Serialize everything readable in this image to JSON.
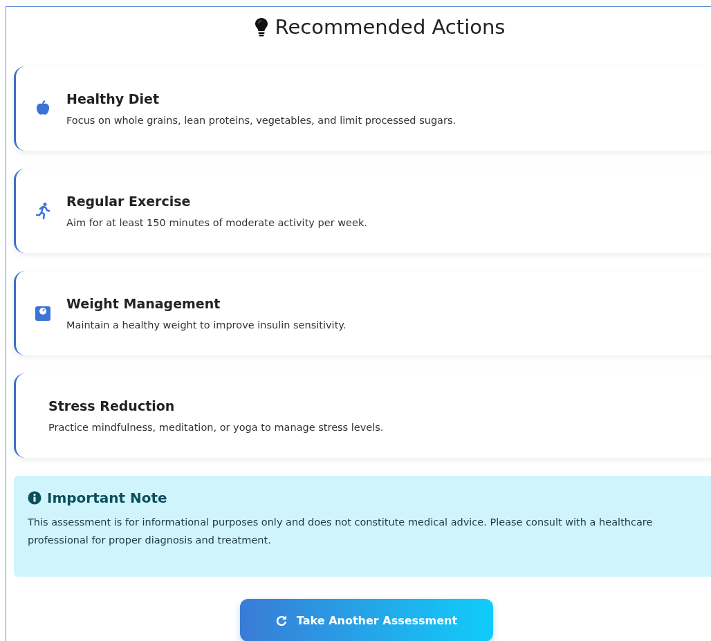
{
  "section": {
    "title": "Recommended Actions"
  },
  "actions": [
    {
      "kind": "apple",
      "title": "Healthy Diet",
      "text": "Focus on whole grains, lean proteins, vegetables, and limit processed sugars."
    },
    {
      "kind": "runner",
      "title": "Regular Exercise",
      "text": "Aim for at least 150 minutes of moderate activity per week."
    },
    {
      "kind": "scale",
      "title": "Weight Management",
      "text": "Maintain a healthy weight to improve insulin sensitivity."
    },
    {
      "kind": "none",
      "title": "Stress Reduction",
      "text": "Practice mindfulness, meditation, or yoga to manage stress levels."
    }
  ],
  "note": {
    "title": "Important Note",
    "text": "This assessment is for informational purposes only and does not constitute medical advice. Please consult with a healthcare professional for proper diagnosis and treatment."
  },
  "button": {
    "label": "Take Another Assessment"
  }
}
